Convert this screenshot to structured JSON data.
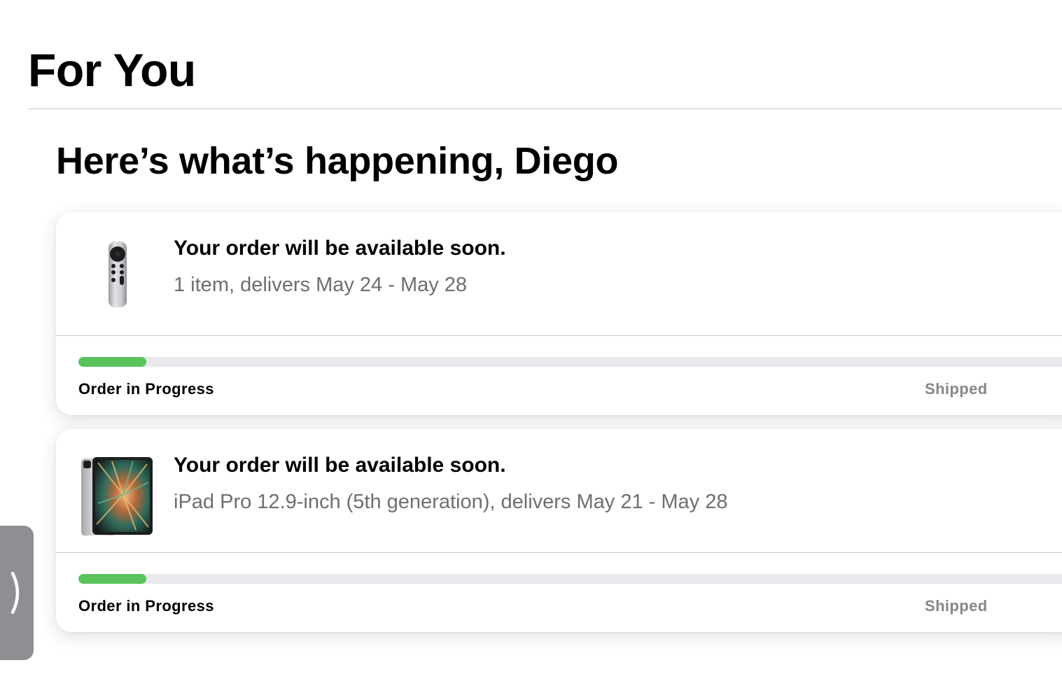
{
  "header": {
    "title": "For You"
  },
  "greeting": "Here’s what’s happening, Diego",
  "orders": [
    {
      "product_icon": "apple-tv-remote-icon",
      "title": "Your order will be available soon.",
      "subtitle": "1 item, delivers May 24 - May 28",
      "progress": 0.068,
      "status_label": "Order in Progress",
      "stage_label": "Shipped"
    },
    {
      "product_icon": "ipad-pro-icon",
      "title": "Your order will be available soon.",
      "subtitle": "iPad Pro 12.9-inch (5th generation), delivers May 21 - May 28",
      "progress": 0.068,
      "status_label": "Order in Progress",
      "stage_label": "Shipped"
    }
  ],
  "sidebar_toggle": {
    "icon": "chevron-right-icon"
  },
  "colors": {
    "progress_fill": "#5ac35c",
    "progress_track": "#e8e8ed",
    "secondary_text": "#6e6e73",
    "stage_text": "#86868b",
    "drawer_tab": "#8e8e93"
  }
}
